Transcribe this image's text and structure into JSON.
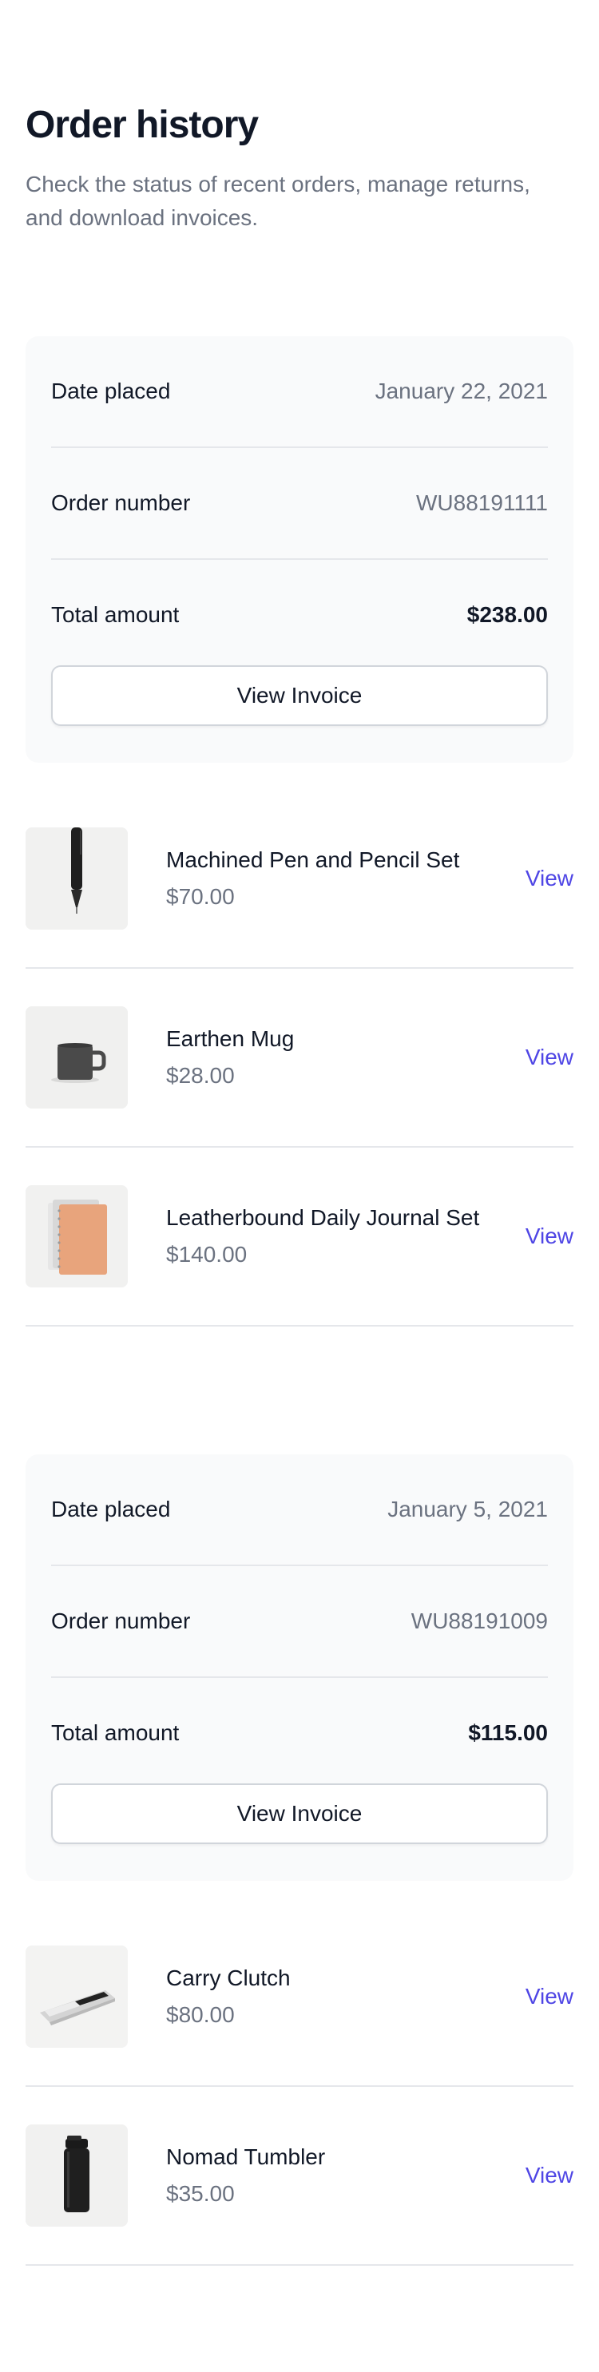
{
  "header": {
    "title": "Order history",
    "subtitle": "Check the status of recent orders, manage returns, and download invoices."
  },
  "orders": [
    {
      "date_label": "Date placed",
      "date_value": "January 22, 2021",
      "number_label": "Order number",
      "number_value": "WU88191111",
      "total_label": "Total amount",
      "total_value": "$238.00",
      "invoice_label": "View Invoice",
      "products": [
        {
          "name": "Machined Pen and Pencil Set",
          "price": "$70.00",
          "link": "View",
          "image_icon": "pen-image"
        },
        {
          "name": "Earthen Mug",
          "price": "$28.00",
          "link": "View",
          "image_icon": "mug-image"
        },
        {
          "name": "Leatherbound Daily Journal Set",
          "price": "$140.00",
          "link": "View",
          "image_icon": "journal-image"
        }
      ]
    },
    {
      "date_label": "Date placed",
      "date_value": "January 5, 2021",
      "number_label": "Order number",
      "number_value": "WU88191009",
      "total_label": "Total amount",
      "total_value": "$115.00",
      "invoice_label": "View Invoice",
      "products": [
        {
          "name": "Carry Clutch",
          "price": "$80.00",
          "link": "View",
          "image_icon": "clutch-image"
        },
        {
          "name": "Nomad Tumbler",
          "price": "$35.00",
          "link": "View",
          "image_icon": "tumbler-image"
        }
      ]
    }
  ],
  "colors": {
    "accent": "#4f46e5",
    "panel": "#f9fafb",
    "muted_text": "#6b7280",
    "border": "#e5e7eb"
  }
}
